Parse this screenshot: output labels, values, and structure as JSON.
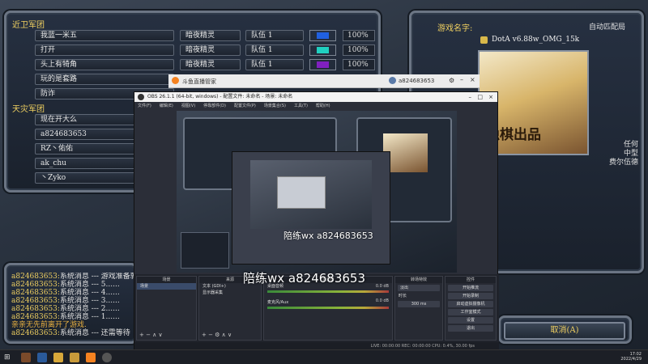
{
  "lobby": {
    "team1_label": "近卫军团",
    "team2_label": "天灾军团",
    "players": [
      {
        "name": "我蓝一米五",
        "race": "暗夜精灵",
        "team": "队伍 1",
        "color": "#2060e0",
        "handicap": "100%"
      },
      {
        "name": "打开",
        "race": "暗夜精灵",
        "team": "队伍 1",
        "color": "#20d0c0",
        "handicap": "100%"
      },
      {
        "name": "头上有犄角",
        "race": "暗夜精灵",
        "team": "队伍 1",
        "color": "#8020c0",
        "handicap": "100%"
      },
      {
        "name": "玩的是套路"
      },
      {
        "name": "防诈"
      },
      {
        "name": "现在开大么"
      },
      {
        "name": "a824683653"
      },
      {
        "name": "RZ丶佑佑"
      },
      {
        "name": "ak_chu"
      },
      {
        "name": "丶Zyko"
      }
    ],
    "game_name_label": "游戏名字:",
    "auto_match": "自动匹配局",
    "map_name": "DotA v6.88w_OMG_15k",
    "map_image_text": "隐棋出品",
    "map_side_text": [
      "任何",
      "中型",
      "费尔伍德"
    ],
    "chat_lines": [
      {
        "who": "a824683653:",
        "msg": "系统消息 --- 游戏准备就"
      },
      {
        "who": "a824683653:",
        "msg": "系统消息 --- 5......"
      },
      {
        "who": "a824683653:",
        "msg": "系统消息 --- 4......"
      },
      {
        "who": "a824683653:",
        "msg": "系统消息 --- 3......"
      },
      {
        "who": "a824683653:",
        "msg": "系统消息 --- 2......"
      },
      {
        "who": "a824683653:",
        "msg": "系统消息 --- 1......"
      },
      {
        "who": "",
        "msg": "亲亲无先前离开了游戏."
      },
      {
        "who": "a824683653:",
        "msg": "系统消息 --- 还需等待"
      }
    ],
    "cancel_label": "取消(A)"
  },
  "douyu": {
    "title": "斗鱼直播管家",
    "user": "a824683653"
  },
  "obs": {
    "title": "OBS 26.1.1 (64-bit, windows) - 配置文件: 未命名 - 场景: 未命名",
    "menu": [
      "文件(F)",
      "编辑(E)",
      "视图(V)",
      "停靠部件(D)",
      "配置文件(P)",
      "场景集合(S)",
      "工具(T)",
      "帮助(H)"
    ],
    "docks": {
      "scenes": "场景",
      "sources": "来源",
      "mixer": "混音器",
      "transitions": "转场特效",
      "controls": "控件"
    },
    "scene_item": "场景",
    "source_items": [
      "文本 (GDI+)",
      "显示器采集"
    ],
    "mixer_items": [
      {
        "name": "桌面音频",
        "db": "0.0 dB"
      },
      {
        "name": "麦克风/Aux",
        "db": "0.0 dB"
      }
    ],
    "transition": "淡出",
    "transition_duration_label": "时长",
    "transition_duration": "300 ms",
    "controls": [
      "开始推流",
      "开始录制",
      "启动虚拟摄像机",
      "工作室模式",
      "设置",
      "退出"
    ],
    "status": "LIVE: 00:00:00   REC: 00:00:00   CPU: 0.4%, 30.00 fps"
  },
  "watermark": {
    "small": "陪练wx  a824683653",
    "big": "陪练wx  a824683653"
  },
  "taskbar": {
    "time": "17:02",
    "date": "2022/4/29"
  }
}
